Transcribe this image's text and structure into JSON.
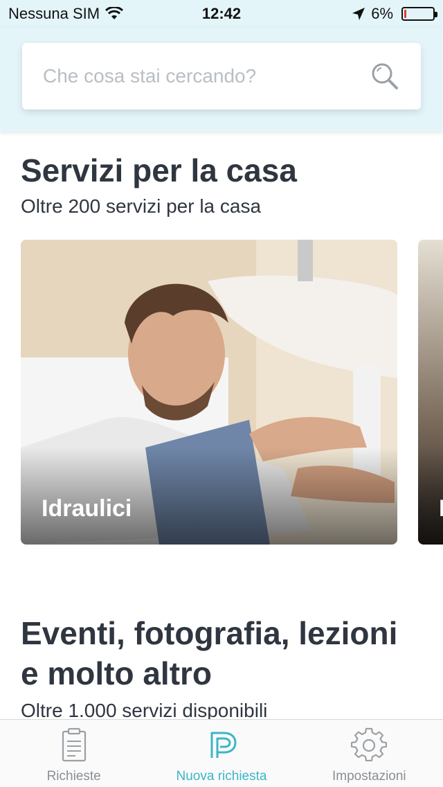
{
  "status_bar": {
    "carrier": "Nessuna SIM",
    "time": "12:42",
    "battery_percent": "6%",
    "battery_level": 0.06,
    "icons": [
      "wifi-icon",
      "location-arrow-icon",
      "battery-icon"
    ]
  },
  "search": {
    "placeholder": "Che cosa stai cercando?",
    "icon": "search-icon"
  },
  "sections": [
    {
      "title": "Servizi per la casa",
      "subtitle": "Oltre 200 servizi per la casa",
      "cards": [
        {
          "label": "Idraulici"
        },
        {
          "label": "I"
        }
      ]
    },
    {
      "title_line1": "Eventi, fotografia, lezioni",
      "title_line2": "e molto altro",
      "subtitle": "Oltre 1.000 servizi disponibili"
    }
  ],
  "tabs": [
    {
      "label": "Richieste",
      "icon": "document-icon",
      "active": false
    },
    {
      "label": "Nuova richiesta",
      "icon": "p-logo-icon",
      "active": true
    },
    {
      "label": "Impostazioni",
      "icon": "gear-icon",
      "active": false
    }
  ],
  "colors": {
    "header_bg": "#e4f5fa",
    "accent": "#3cb5c8",
    "text_dark": "#2f3640",
    "battery_low": "#e53935"
  }
}
